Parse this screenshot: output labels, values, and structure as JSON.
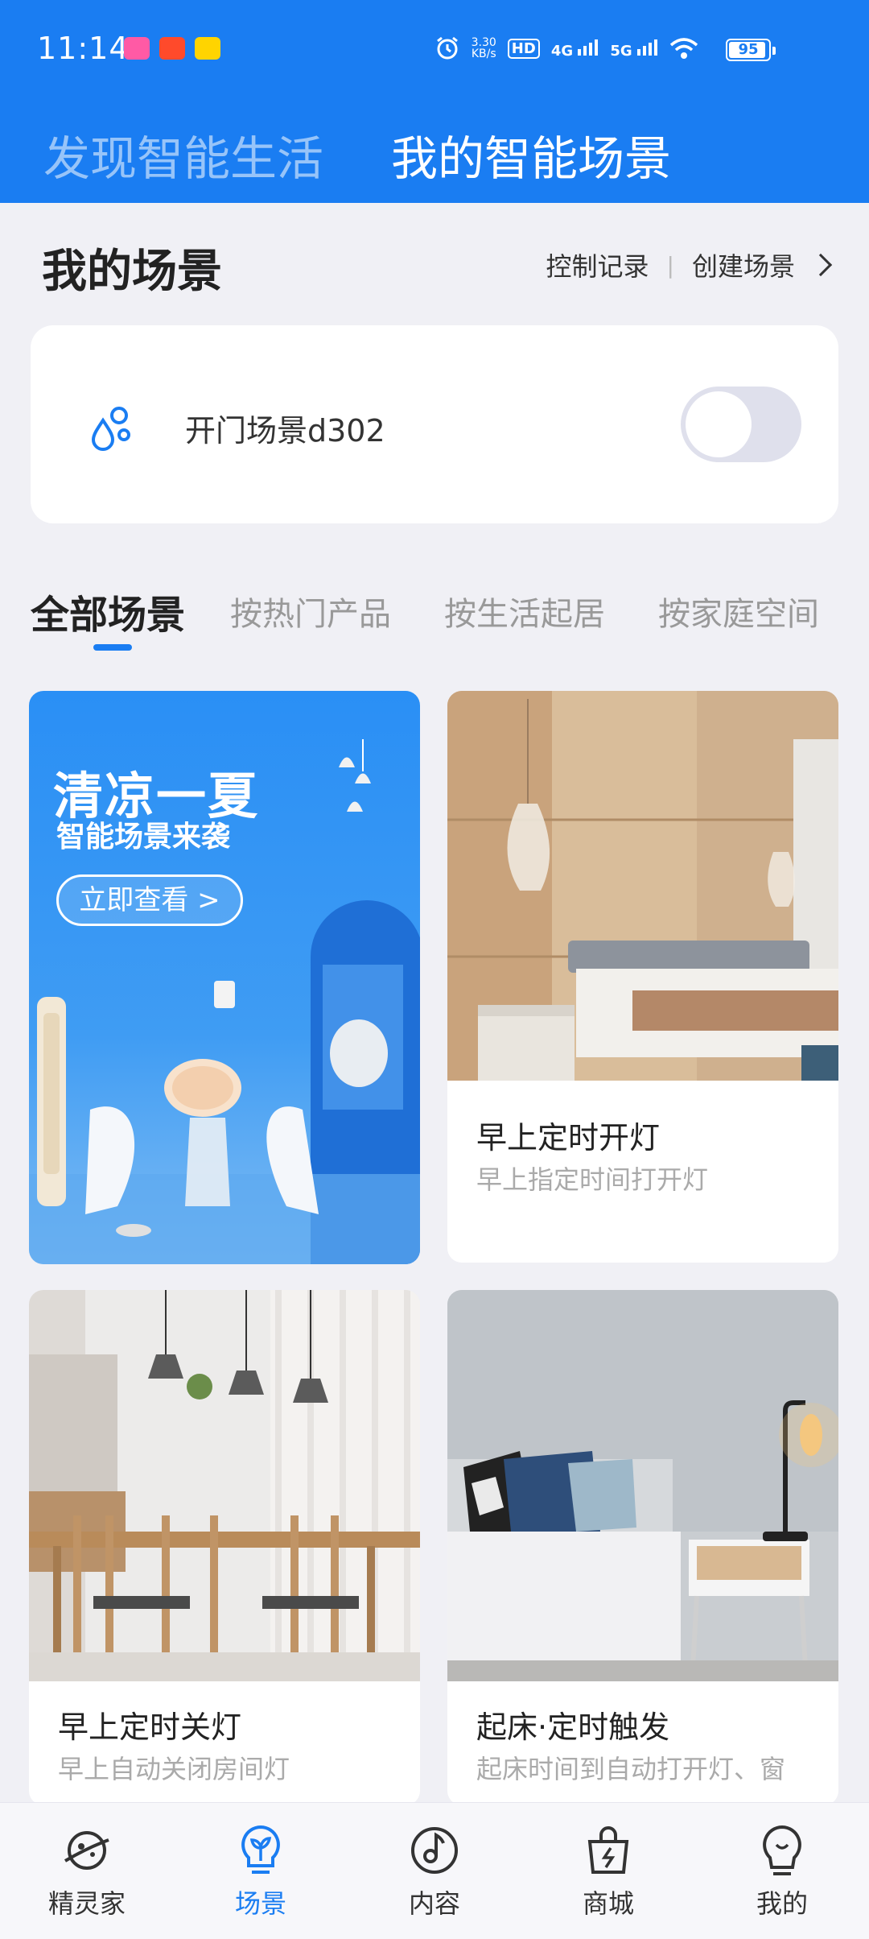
{
  "status_bar": {
    "time": "11:14",
    "net_speed_value": "3.30",
    "net_speed_unit": "KB/s",
    "hd_label": "HD",
    "sig1_label": "4G",
    "sig2_label": "5G",
    "battery": "95"
  },
  "header": {
    "tabs": [
      {
        "label": "发现智能生活",
        "active": false
      },
      {
        "label": "我的智能场景",
        "active": true
      }
    ]
  },
  "my_scenes": {
    "title": "我的场景",
    "control_record": "控制记录",
    "separator": "|",
    "create_scene": "创建场景",
    "scene": {
      "name": "开门场景d302",
      "enabled": false
    }
  },
  "categories": {
    "tabs": [
      "全部场景",
      "按热门产品",
      "按生活起居",
      "按家庭空间"
    ],
    "active_index": 0
  },
  "promo": {
    "headline": "清凉一夏",
    "subline": "智能场景来袭",
    "button": "立即查看 >"
  },
  "cards": [
    {
      "title": "早上定时开灯",
      "subtitle": "早上指定时间打开灯"
    },
    {
      "title": "早上定时关灯",
      "subtitle": "早上自动关闭房间灯"
    },
    {
      "title": "起床·定时触发",
      "subtitle": "起床时间到自动打开灯、窗"
    }
  ],
  "bottom_nav": {
    "items": [
      {
        "label": "精灵家",
        "icon": "planet-icon"
      },
      {
        "label": "场景",
        "icon": "sprout-bulb-icon"
      },
      {
        "label": "内容",
        "icon": "music-note-icon"
      },
      {
        "label": "商城",
        "icon": "shopping-bag-icon"
      },
      {
        "label": "我的",
        "icon": "profile-bulb-icon"
      }
    ],
    "active_index": 1
  },
  "colors": {
    "accent": "#1a7df2",
    "background": "#f0f0f5",
    "toggle_off": "#dfe0ec"
  }
}
